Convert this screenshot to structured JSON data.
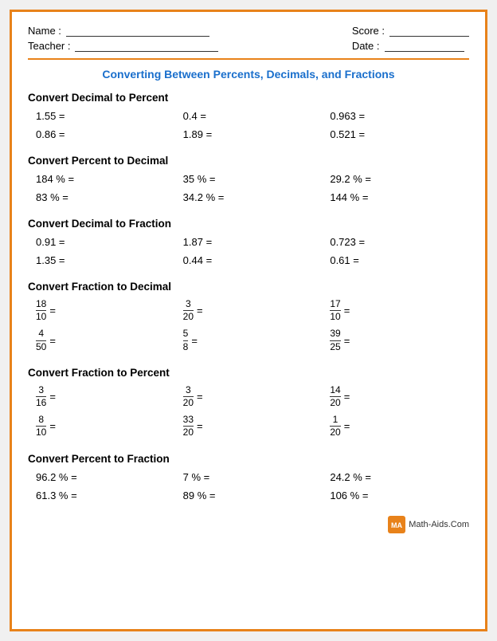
{
  "header": {
    "name_label": "Name :",
    "teacher_label": "Teacher :",
    "score_label": "Score :",
    "date_label": "Date :"
  },
  "title": "Converting Between Percents, Decimals, and Fractions",
  "sections": [
    {
      "id": "decimal-to-percent",
      "title": "Convert Decimal to Percent",
      "rows": [
        [
          "1.55 =",
          "0.4 =",
          "0.963 ="
        ],
        [
          "0.86 =",
          "1.89 =",
          "0.521 ="
        ]
      ],
      "type": "plain"
    },
    {
      "id": "percent-to-decimal",
      "title": "Convert Percent to Decimal",
      "rows": [
        [
          "184 % =",
          "35 % =",
          "29.2 % ="
        ],
        [
          "83 % =",
          "34.2 % =",
          "144 % ="
        ]
      ],
      "type": "plain"
    },
    {
      "id": "decimal-to-fraction",
      "title": "Convert Decimal to Fraction",
      "rows": [
        [
          "0.91 =",
          "1.87 =",
          "0.723 ="
        ],
        [
          "1.35 =",
          "0.44 =",
          "0.61 ="
        ]
      ],
      "type": "plain"
    },
    {
      "id": "fraction-to-decimal",
      "title": "Convert Fraction to Decimal",
      "rows": [
        [
          {
            "num": "18",
            "den": "10"
          },
          {
            "num": "3",
            "den": "20"
          },
          {
            "num": "17",
            "den": "10"
          }
        ],
        [
          {
            "num": "4",
            "den": "50"
          },
          {
            "num": "5",
            "den": "8"
          },
          {
            "num": "39",
            "den": "25"
          }
        ]
      ],
      "type": "fraction"
    },
    {
      "id": "fraction-to-percent",
      "title": "Convert Fraction to Percent",
      "rows": [
        [
          {
            "num": "3",
            "den": "16"
          },
          {
            "num": "3",
            "den": "20"
          },
          {
            "num": "14",
            "den": "20"
          }
        ],
        [
          {
            "num": "8",
            "den": "10"
          },
          {
            "num": "33",
            "den": "20"
          },
          {
            "num": "1",
            "den": "20"
          }
        ]
      ],
      "type": "fraction"
    },
    {
      "id": "percent-to-fraction",
      "title": "Convert Percent to Fraction",
      "rows": [
        [
          "96.2 % =",
          "7 % =",
          "24.2 % ="
        ],
        [
          "61.3 % =",
          "89 % =",
          "106 % ="
        ]
      ],
      "type": "plain"
    }
  ],
  "footer": {
    "logo_text": "Math-Aids.Com"
  }
}
